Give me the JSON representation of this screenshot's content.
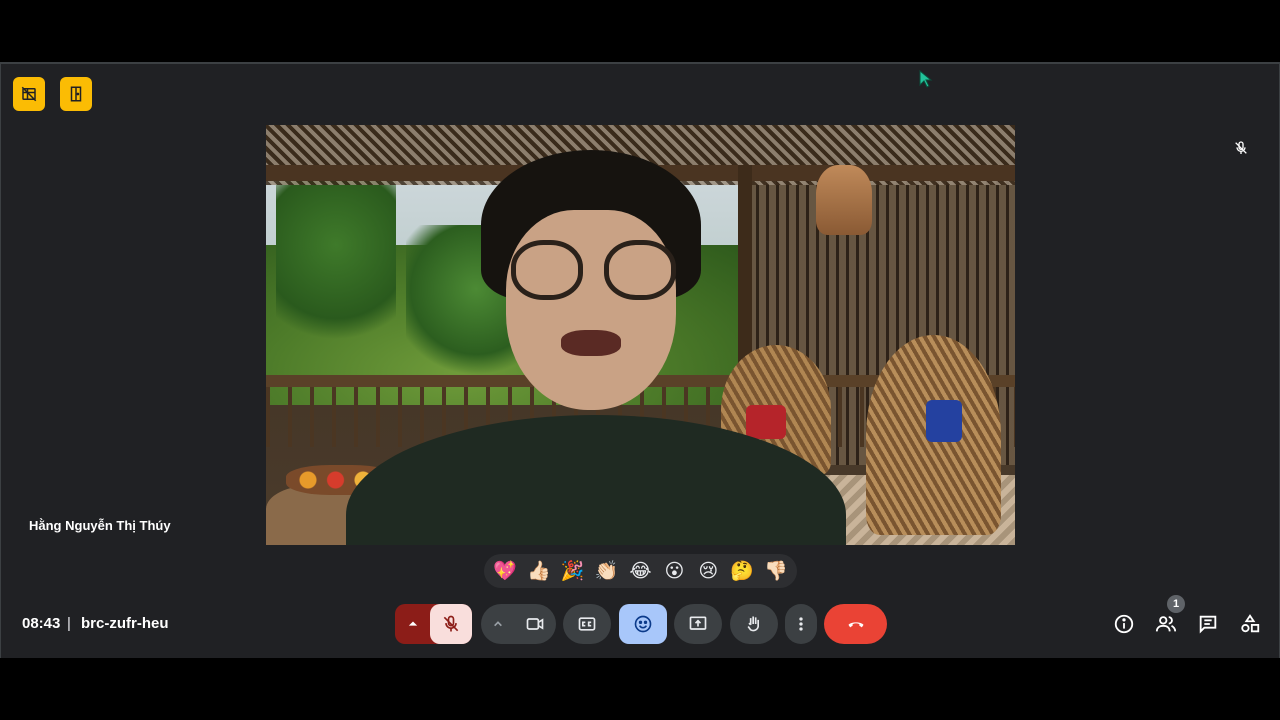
{
  "participant": {
    "name": "Hằng Nguyễn Thị Thúy"
  },
  "meeting": {
    "time": "08:43",
    "separator": "|",
    "code": "brc-zufr-heu"
  },
  "participants_count": "1",
  "reactions": [
    {
      "name": "sparkling-heart",
      "glyph": "💖"
    },
    {
      "name": "thumbs-up",
      "glyph": "👍🏻"
    },
    {
      "name": "party-popper",
      "glyph": "🎉"
    },
    {
      "name": "clapping-hands",
      "glyph": "👏🏻"
    },
    {
      "name": "tears-of-joy",
      "glyph": "😂"
    },
    {
      "name": "surprised-face",
      "glyph": "😮"
    },
    {
      "name": "sad-face",
      "glyph": "😢"
    },
    {
      "name": "thinking-face",
      "glyph": "🤔"
    },
    {
      "name": "thumbs-down",
      "glyph": "👎🏻"
    }
  ],
  "icons": {
    "top_left": [
      "no-video-grid-icon",
      "room-door-icon"
    ],
    "tile": "mic-off-icon",
    "controls": [
      "chevron-up-icon",
      "mic-off-icon",
      "chevron-up-icon",
      "video-camera-icon",
      "captions-icon",
      "emoji-icon",
      "present-screen-icon",
      "raise-hand-icon",
      "more-vert-icon",
      "call-end-icon"
    ],
    "side": [
      "info-icon",
      "people-icon",
      "chat-icon",
      "activities-icon"
    ]
  },
  "colors": {
    "background": "#202124",
    "badge_yellow": "#fbbc04",
    "mic_off_red": "#8c1d18",
    "mic_off_pink": "#f9dedc",
    "control_gray": "#3c4043",
    "emoji_active": "#a8c7fa",
    "hangup_red": "#ea4335"
  }
}
